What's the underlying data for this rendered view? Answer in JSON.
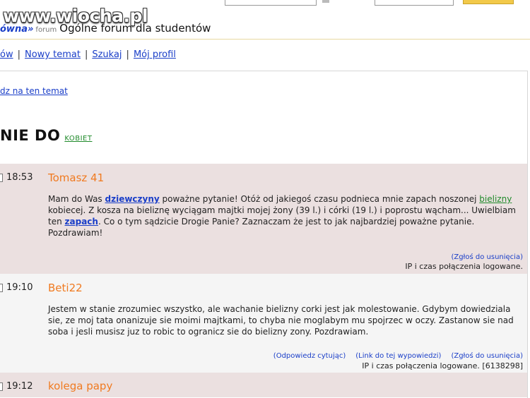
{
  "watermark": "www.wiocha.pl",
  "breadcrumb": {
    "forum_link": "ówna»",
    "forum_small": "forum",
    "title": "Ogólne forum dla studentów"
  },
  "nav": {
    "items": [
      {
        "label": "ów"
      },
      {
        "label": "Nowy temat"
      },
      {
        "label": "Szukaj"
      },
      {
        "label": "Mój profil"
      }
    ],
    "separator": "|"
  },
  "reply_link": "dz na ten temat",
  "topic": {
    "title": "NIE DO",
    "tag": "KOBIET"
  },
  "posts": [
    {
      "time": "18:53",
      "author": "Tomasz 41",
      "body": {
        "p1": "Mam do Was ",
        "kw1": "dziewczyny",
        "p2": " poważne pytanie! Otóż od jakiegoś czasu podnieca mnie zapach noszonej ",
        "kw2": "bielizny",
        "p3": " kobiecej. Z kosza na bieliznę wyciągam majtki mojej żony (39 l.) i córki (19 l.) i poprostu wącham... Uwielbiam ten ",
        "kw3": "zapach",
        "p4": ". Co o tym sądzicie Drogie Panie? Zaznaczam że jest to jak najbardziej poważne pytanie. Pozdrawiam!"
      },
      "report": "(Zgłoś do usunięcia)",
      "ip": "IP i czas połączenia logowane."
    },
    {
      "time": "19:10",
      "author": "Beti22",
      "text": "Jestem w stanie zrozumiec wszystko, ale wachanie bielizny corki jest jak molestowanie. Gdybym dowiedziala sie, ze moj tata onanizuje sie moimi majtkami, to chyba nie moglabym mu spojrzec w oczy. Zastanow sie nad soba i jesli musisz juz to robic to ogranicz sie do bielizny zony. Pozdrawiam.",
      "quote": "(Odpowiedz cytując)",
      "link": "(Link do tej wypowiedzi)",
      "report": "(Zgłoś do usunięcia)",
      "ip": "IP i czas połączenia logowane. [6138298]"
    },
    {
      "time": "19:12",
      "author": "kolega papy"
    }
  ]
}
